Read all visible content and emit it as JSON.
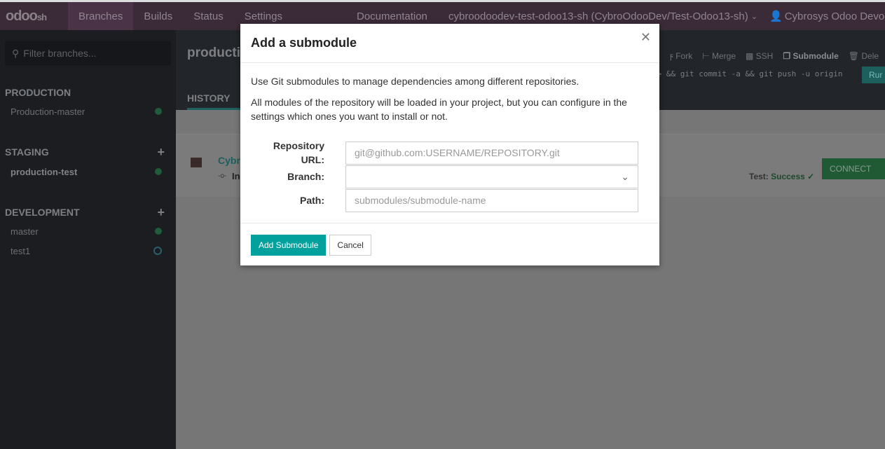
{
  "topbar": {
    "logo": "odoo",
    "logo_suffix": "sh",
    "nav": [
      "Branches",
      "Builds",
      "Status",
      "Settings"
    ],
    "documentation": "Documentation",
    "project": "cybroodoodev-test-odoo13-sh (CybroOdooDev/Test-Odoo13-sh)",
    "user": "Cybrosys Odoo Devops"
  },
  "sidebar": {
    "filter_placeholder": "Filter branches...",
    "production": {
      "title": "PRODUCTION",
      "items": [
        {
          "label": "Production-master",
          "status": "success"
        }
      ]
    },
    "staging": {
      "title": "STAGING",
      "items": [
        {
          "label": "production-test",
          "status": "success"
        }
      ]
    },
    "development": {
      "title": "DEVELOPMENT",
      "items": [
        {
          "label": "master",
          "status": "success"
        },
        {
          "label": "test1",
          "status": "building"
        }
      ]
    }
  },
  "main": {
    "branch_title": "productio",
    "tab_history": "HISTORY",
    "actions": {
      "fork": "Fork",
      "merge": "Merge",
      "ssh": "SSH",
      "submodule": "Submodule",
      "delete": "Dele"
    },
    "command": "H> && git commit -a && git push -u origin",
    "run": "Rur",
    "commit_title": "Cybr",
    "commit_line": "In",
    "test_label": "Test:",
    "test_status": "Success",
    "connect": "CONNECT"
  },
  "modal": {
    "title": "Add a submodule",
    "intro": "Use Git submodules to manage dependencies among different repositories.",
    "info": "All modules of the repository will be loaded in your project, but you can configure in the settings which ones you want to install or not.",
    "repo_label": "Repository URL:",
    "repo_placeholder": "git@github.com:USERNAME/REPOSITORY.git",
    "branch_label": "Branch:",
    "branch_value": "",
    "path_label": "Path:",
    "path_placeholder": "submodules/submodule-name",
    "submit": "Add Submodule",
    "cancel": "Cancel"
  },
  "colors": {
    "accent": "#00a09d",
    "topbar": "#3b2a38",
    "sidebar": "#1b1d21",
    "success": "#1e5c3a"
  }
}
